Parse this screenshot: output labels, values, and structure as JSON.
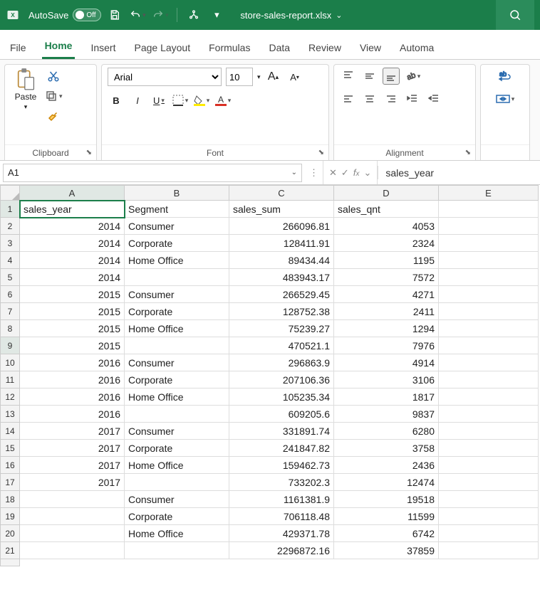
{
  "titlebar": {
    "autosave_label": "AutoSave",
    "autosave_state": "Off",
    "filename": "store-sales-report.xlsx"
  },
  "tabs": [
    "File",
    "Home",
    "Insert",
    "Page Layout",
    "Formulas",
    "Data",
    "Review",
    "View",
    "Automa"
  ],
  "active_tab": "Home",
  "ribbon": {
    "clipboard": {
      "paste": "Paste",
      "label": "Clipboard"
    },
    "font": {
      "name": "Arial",
      "size": "10",
      "bold": "B",
      "italic": "I",
      "underline": "U",
      "label": "Font"
    },
    "alignment": {
      "label": "Alignment"
    }
  },
  "namebox": "A1",
  "formula": "sales_year",
  "columns": [
    "A",
    "B",
    "C",
    "D",
    "E"
  ],
  "headers": {
    "A": "sales_year",
    "B": "Segment",
    "C": "sales_sum",
    "D": "sales_qnt"
  },
  "rows": [
    {
      "r": 2,
      "A": "2014",
      "B": "Consumer",
      "C": "266096.81",
      "D": "4053"
    },
    {
      "r": 3,
      "A": "2014",
      "B": "Corporate",
      "C": "128411.91",
      "D": "2324"
    },
    {
      "r": 4,
      "A": "2014",
      "B": "Home Office",
      "C": "89434.44",
      "D": "1195"
    },
    {
      "r": 5,
      "A": "2014",
      "B": "",
      "C": "483943.17",
      "D": "7572"
    },
    {
      "r": 6,
      "A": "2015",
      "B": "Consumer",
      "C": "266529.45",
      "D": "4271"
    },
    {
      "r": 7,
      "A": "2015",
      "B": "Corporate",
      "C": "128752.38",
      "D": "2411"
    },
    {
      "r": 8,
      "A": "2015",
      "B": "Home Office",
      "C": "75239.27",
      "D": "1294"
    },
    {
      "r": 9,
      "A": "2015",
      "B": "",
      "C": "470521.1",
      "D": "7976"
    },
    {
      "r": 10,
      "A": "2016",
      "B": "Consumer",
      "C": "296863.9",
      "D": "4914"
    },
    {
      "r": 11,
      "A": "2016",
      "B": "Corporate",
      "C": "207106.36",
      "D": "3106"
    },
    {
      "r": 12,
      "A": "2016",
      "B": "Home Office",
      "C": "105235.34",
      "D": "1817"
    },
    {
      "r": 13,
      "A": "2016",
      "B": "",
      "C": "609205.6",
      "D": "9837"
    },
    {
      "r": 14,
      "A": "2017",
      "B": "Consumer",
      "C": "331891.74",
      "D": "6280"
    },
    {
      "r": 15,
      "A": "2017",
      "B": "Corporate",
      "C": "241847.82",
      "D": "3758"
    },
    {
      "r": 16,
      "A": "2017",
      "B": "Home Office",
      "C": "159462.73",
      "D": "2436"
    },
    {
      "r": 17,
      "A": "2017",
      "B": "",
      "C": "733202.3",
      "D": "12474"
    },
    {
      "r": 18,
      "A": "",
      "B": "Consumer",
      "C": "1161381.9",
      "D": "19518"
    },
    {
      "r": 19,
      "A": "",
      "B": "Corporate",
      "C": "706118.48",
      "D": "11599"
    },
    {
      "r": 20,
      "A": "",
      "B": "Home Office",
      "C": "429371.78",
      "D": "6742"
    },
    {
      "r": 21,
      "A": "",
      "B": "",
      "C": "2296872.16",
      "D": "37859"
    }
  ],
  "selected_cell": "A1",
  "selected_row": 9
}
